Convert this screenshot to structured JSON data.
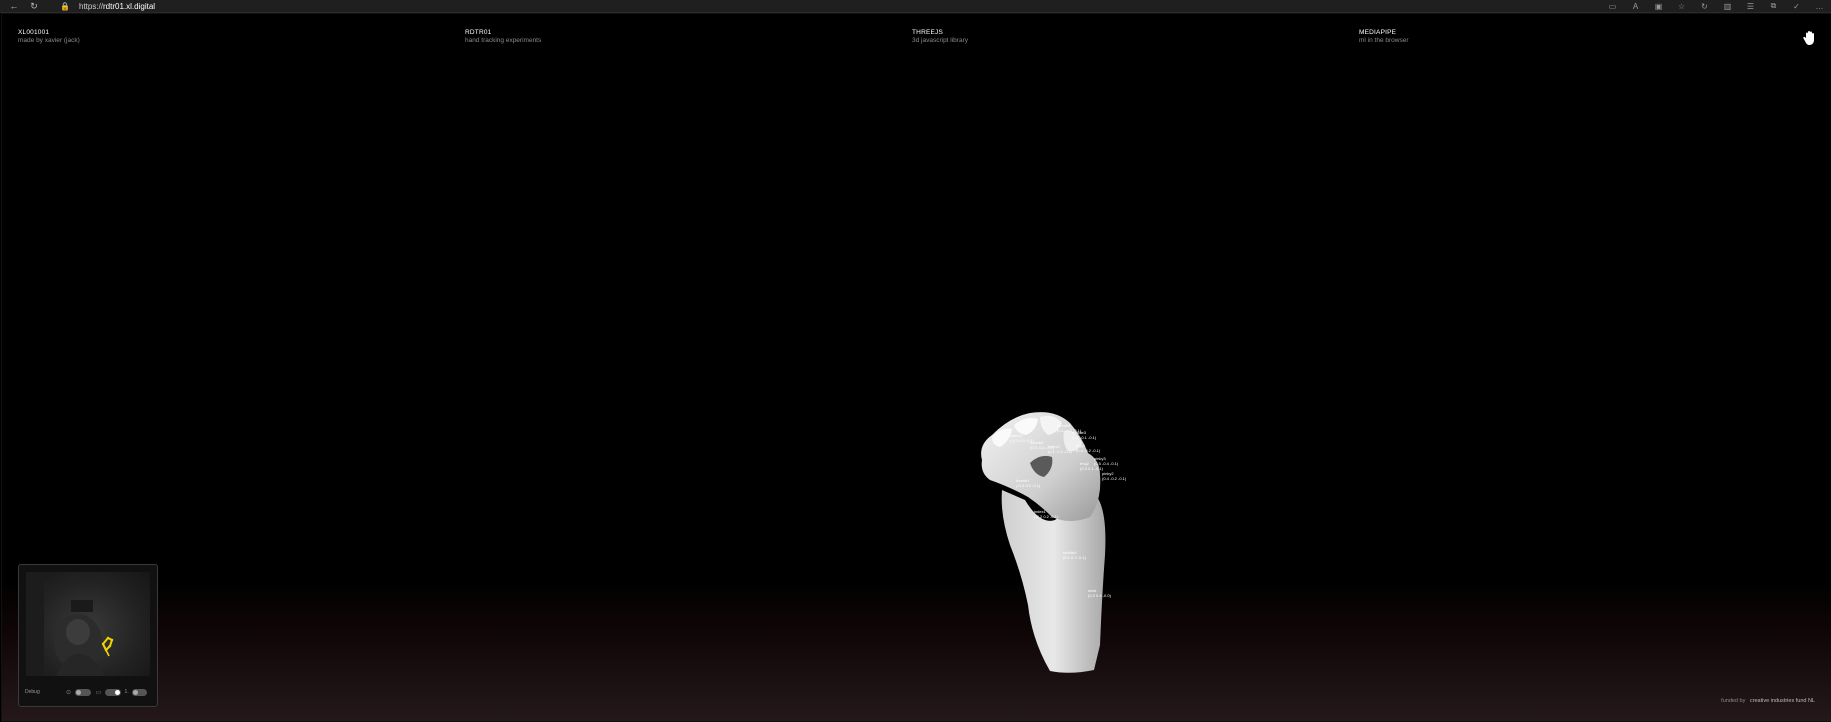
{
  "browser": {
    "back_icon": "←",
    "reload_icon": "↻",
    "lock_icon": "🔒",
    "url_prefix": "https://",
    "url_host": "rdtr01.xl.digital",
    "right_icons": [
      "▭",
      "A",
      "▣",
      "☆",
      "↻",
      "▥",
      "☰",
      "⧉",
      "✓",
      "…"
    ]
  },
  "header": {
    "cols": [
      {
        "title": "XL001001",
        "sub": "made by xavier (jack)"
      },
      {
        "title": "RDTR01",
        "sub": "hand tracking experiments"
      },
      {
        "title": "THREEJS",
        "sub": "3d javascript library"
      },
      {
        "title": "MEDIAPIPE",
        "sub": "ml in the browser"
      }
    ]
  },
  "landmarks": [
    {
      "name": "thumb3",
      "vals": "(0.1 -0.5 -0.1)"
    },
    {
      "name": "index3",
      "vals": "(-0.1 0.0 -0.1)"
    },
    {
      "name": "middle3",
      "vals": "(0.2 -0.1 -0.1)"
    },
    {
      "name": "ring3",
      "vals": "(0.4 -0.2 -0.1)"
    },
    {
      "name": "pinky3",
      "vals": "(0.5 -0.4 -0.1)"
    },
    {
      "name": "thumb2",
      "vals": "(0.0 -0.4 -0.1)"
    },
    {
      "name": "index2",
      "vals": "(0.1 -0.2 -0.1)"
    },
    {
      "name": "ring2",
      "vals": "(0.3 0.1 -0.1)"
    },
    {
      "name": "pinky2",
      "vals": "(0.4 -0.2 -0.1)"
    },
    {
      "name": "thumb1",
      "vals": "(-0.3 0.0 -0.1)"
    },
    {
      "name": "index1",
      "vals": "(-0.2 0.2 -0.1)"
    },
    {
      "name": "middle1",
      "vals": "(0.1 0.3 -0.1)"
    },
    {
      "name": "wrist",
      "vals": "(0.2 0.4 -0.0)"
    }
  ],
  "debug": {
    "label": "Debug",
    "icons": [
      "⊙",
      "▭"
    ],
    "dots": "1."
  },
  "footer": {
    "prefix": "funded by",
    "brand": "creative industries fund NL"
  },
  "colors": {
    "accent_yellow": "#f2d400",
    "background": "#000000",
    "floor_tint": "#24181a"
  }
}
